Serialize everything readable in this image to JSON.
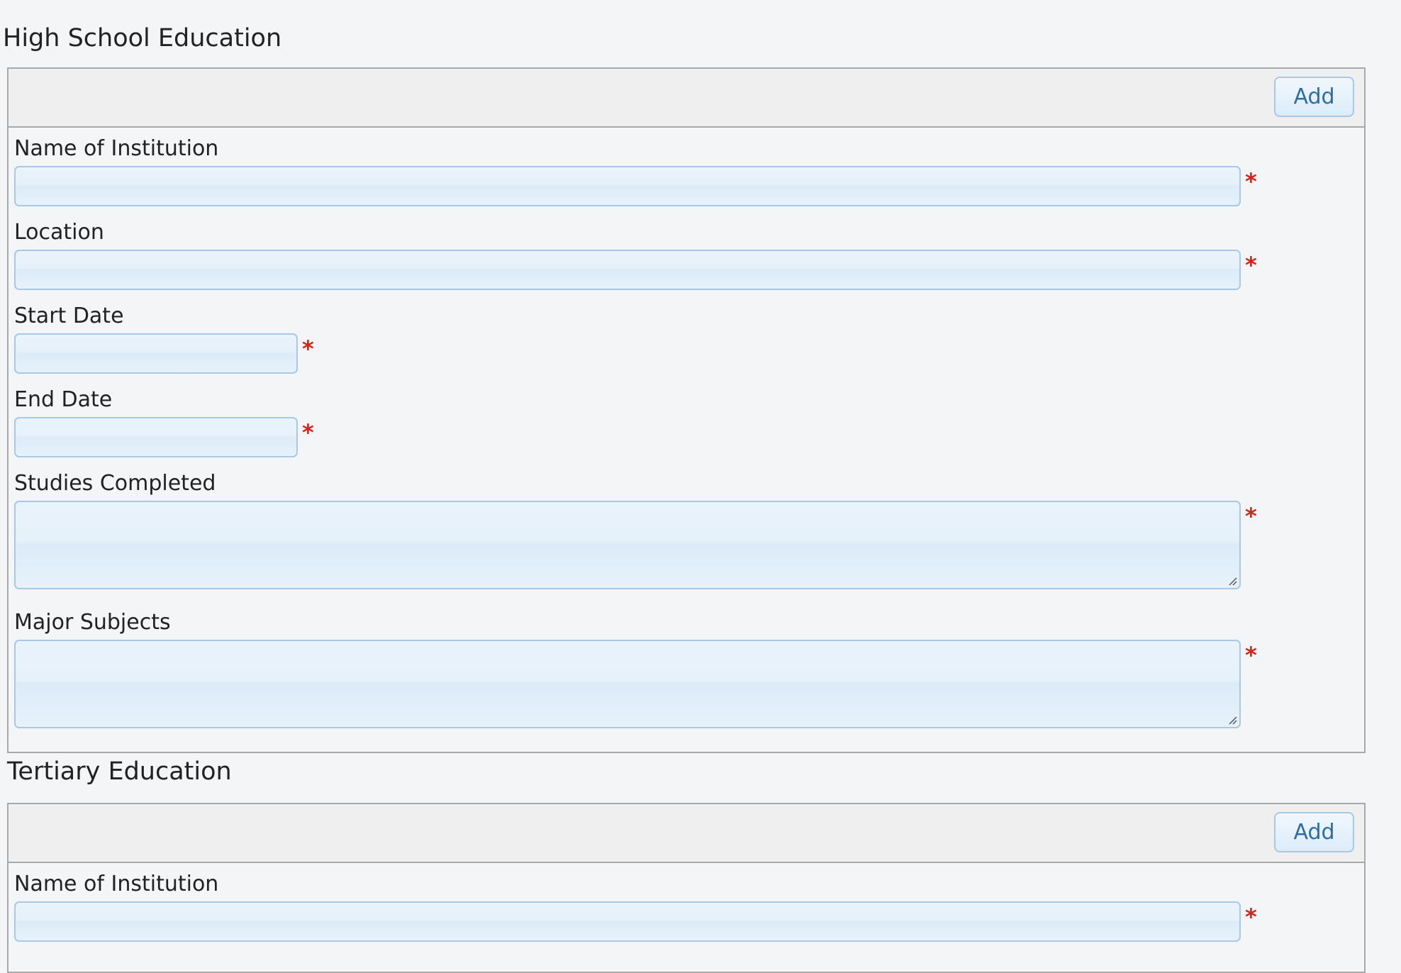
{
  "high_school": {
    "title": "High School Education",
    "add_label": "Add",
    "fields": {
      "name_of_institution": {
        "label": "Name of Institution",
        "value": "",
        "required_marker": "*"
      },
      "location": {
        "label": "Location",
        "value": "",
        "required_marker": "*"
      },
      "start_date": {
        "label": "Start Date",
        "value": "",
        "required_marker": "*"
      },
      "end_date": {
        "label": "End Date",
        "value": "",
        "required_marker": "*"
      },
      "studies_completed": {
        "label": "Studies Completed",
        "value": "",
        "required_marker": "*"
      },
      "major_subjects": {
        "label": "Major Subjects",
        "value": "",
        "required_marker": "*"
      }
    }
  },
  "tertiary": {
    "title": "Tertiary Education",
    "add_label": "Add",
    "fields": {
      "name_of_institution": {
        "label": "Name of Institution",
        "value": "",
        "required_marker": "*"
      }
    }
  },
  "colors": {
    "required": "#d9221c",
    "input_border": "#a9c8e6",
    "button_text": "#2e6da4",
    "panel_border": "#a9a9a9"
  }
}
